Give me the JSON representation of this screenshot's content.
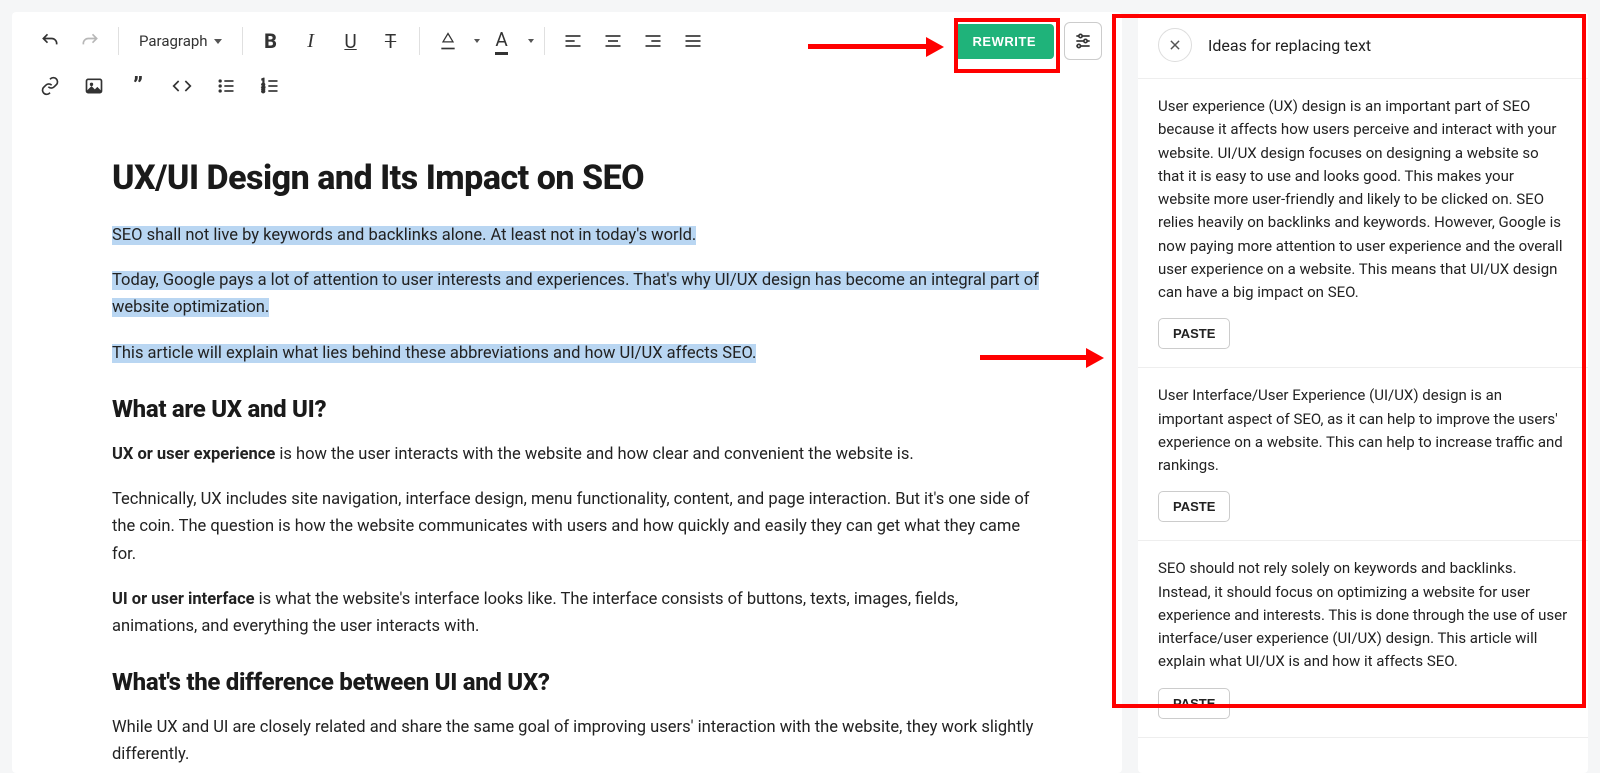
{
  "toolbar": {
    "paragraph_label": "Paragraph",
    "rewrite_label": "REWRITE"
  },
  "document": {
    "h1": "UX/UI Design and Its Impact on SEO",
    "p1": "SEO shall not live by keywords and backlinks alone. At least not in today's world.",
    "p2": "Today, Google pays a lot of attention to user interests and experiences. That's why UI/UX design has become an integral part of website optimization.",
    "p3": "This article will explain what lies behind these abbreviations and how UI/UX affects SEO.",
    "h2a": "What are UX and UI?",
    "p4_bold": "UX or user experience",
    "p4_rest": " is how the user interacts with the website and how clear and convenient the website is.",
    "p5": "Technically, UX includes site navigation, interface design, menu functionality, content, and page interaction. But it's one side of the coin. The question is how the website communicates with users and how quickly and easily they can get what they came for.",
    "p6_bold": "UI or user interface",
    "p6_rest": " is what the website's interface looks like. The interface consists of buttons, texts, images, fields, animations, and everything the user interacts with.",
    "h2b": "What's the difference between UI and UX?",
    "p7": "While UX and UI are closely related and share the same goal of improving users' interaction with the website, they work slightly differently."
  },
  "sidebar": {
    "title": "Ideas for replacing text",
    "paste_label": "PASTE",
    "suggestions": [
      "User experience (UX) design is an important part of SEO because it affects how users perceive and interact with your website. UI/UX design focuses on designing a website so that it is easy to use and looks good. This makes your website more user-friendly and likely to be clicked on. SEO relies heavily on backlinks and keywords. However, Google is now paying more attention to user experience and the overall user experience on a website. This means that UI/UX design can have a big impact on SEO.",
      "User Interface/User Experience (UI/UX) design is an important aspect of SEO, as it can help to improve the users' experience on a website. This can help to increase traffic and rankings.",
      "SEO should not rely solely on keywords and backlinks. Instead, it should focus on optimizing a website for user experience and interests. This is done through the use of user interface/user experience (UI/UX) design. This article will explain what UI/UX is and how it affects SEO."
    ]
  }
}
